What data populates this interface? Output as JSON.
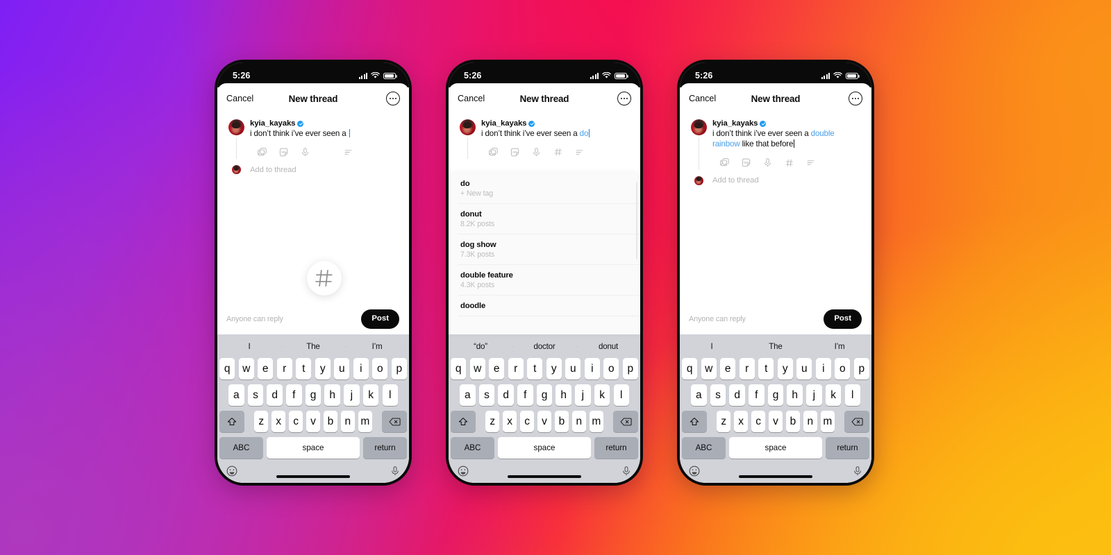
{
  "background": {
    "gradient_colors": [
      "#7F1FF5",
      "#D4199B",
      "#F5104E",
      "#FA5A22",
      "#FB9218",
      "#FCBE10",
      "#AE38BE"
    ]
  },
  "common": {
    "status_bar": {
      "time": "5:26",
      "signal_icon": "cellular-bars-icon",
      "wifi_icon": "wifi-icon",
      "battery_icon": "battery-icon"
    },
    "nav": {
      "cancel_label": "Cancel",
      "title": "New thread",
      "more_icon": "more-options-icon"
    },
    "account": {
      "username": "kyia_kayaks",
      "verified": true
    },
    "composer_icons": [
      "photo-icon",
      "gif-icon",
      "microphone-icon",
      "hashtag-icon",
      "poll-icon"
    ],
    "add_to_thread_label": "Add to thread",
    "reply_note": "Anyone can reply",
    "post_label": "Post",
    "accent_link_color": "#4a9ee6",
    "post_button_color": "#0a0a0a"
  },
  "keyboard": {
    "row1": [
      "q",
      "w",
      "e",
      "r",
      "t",
      "y",
      "u",
      "i",
      "o",
      "p"
    ],
    "row2": [
      "a",
      "s",
      "d",
      "f",
      "g",
      "h",
      "j",
      "k",
      "l"
    ],
    "row3": [
      "z",
      "x",
      "c",
      "v",
      "b",
      "n",
      "m"
    ],
    "shift_icon": "shift-icon",
    "backspace_icon": "backspace-icon",
    "abc_label": "ABC",
    "space_label": "space",
    "return_label": "return",
    "emoji_icon": "emoji-icon",
    "dictation_icon": "microphone-icon"
  },
  "phones": [
    {
      "id": "phone-1",
      "post_text_prefix": "i don’t think i’ve ever seen a ",
      "post_text_tag": "",
      "post_text_suffix": "",
      "magnified_icon": "hashtag-icon",
      "predictions": [
        "I",
        "The",
        "I’m"
      ],
      "suggestions": []
    },
    {
      "id": "phone-2",
      "post_text_prefix": "i don’t think i’ve ever seen a ",
      "post_text_tag": "do",
      "post_text_suffix": "",
      "magnified_icon": "",
      "predictions": [
        "“do”",
        "doctor",
        "donut"
      ],
      "suggestions": [
        {
          "name": "do",
          "meta": "+ New tag"
        },
        {
          "name": "donut",
          "meta": "8.2K posts"
        },
        {
          "name": "dog show",
          "meta": "7.3K posts"
        },
        {
          "name": "double feature",
          "meta": "4.3K posts"
        },
        {
          "name": "doodle",
          "meta": ""
        }
      ]
    },
    {
      "id": "phone-3",
      "post_text_prefix": "i don’t think i’ve ever seen a ",
      "post_text_tag": "double rainbow",
      "post_text_suffix": " like that before",
      "magnified_icon": "",
      "predictions": [
        "I",
        "The",
        "I’m"
      ],
      "suggestions": []
    }
  ]
}
